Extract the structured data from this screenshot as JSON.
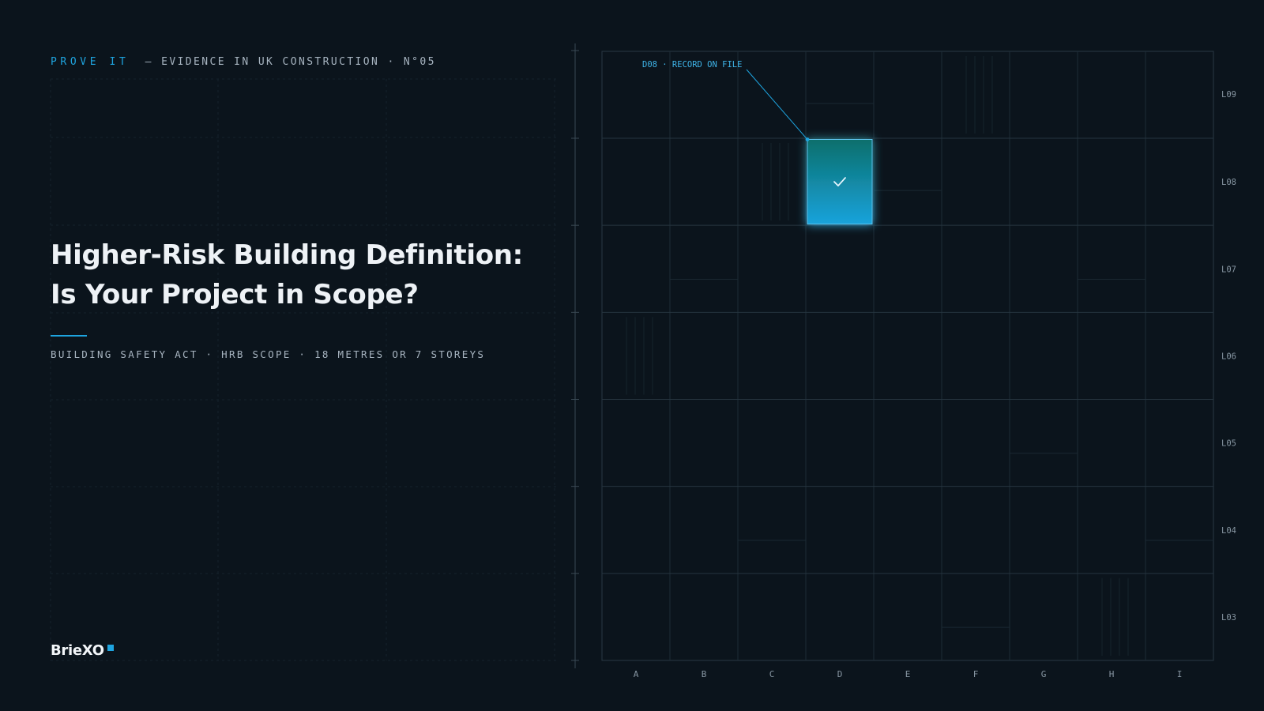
{
  "header": {
    "series_name": "PROVE IT",
    "series_tagline": "— EVIDENCE IN UK CONSTRUCTION · N°05"
  },
  "title": {
    "line1": "Higher-Risk Building Definition:",
    "line2": "Is Your Project in Scope?"
  },
  "subtitle": "BUILDING SAFETY ACT · HRB SCOPE · 18 METRES OR 7 STOREYS",
  "brand": {
    "name": "BrieXO"
  },
  "grid": {
    "columns": [
      "A",
      "B",
      "C",
      "D",
      "E",
      "F",
      "G",
      "H",
      "I"
    ],
    "levels": [
      "L09",
      "L08",
      "L07",
      "L06",
      "L05",
      "L04",
      "L03"
    ],
    "highlight": {
      "column": "D",
      "level": "L08",
      "label": "D08 · RECORD ON FILE",
      "icon": "check-icon"
    }
  },
  "colors": {
    "background": "#0b141c",
    "accent": "#1ea4df",
    "cell_gradient_top": "#0a6f6c",
    "cell_gradient_bottom": "#1aa3dc",
    "text_primary": "#eef2f6",
    "text_muted": "#a7b4c0"
  }
}
